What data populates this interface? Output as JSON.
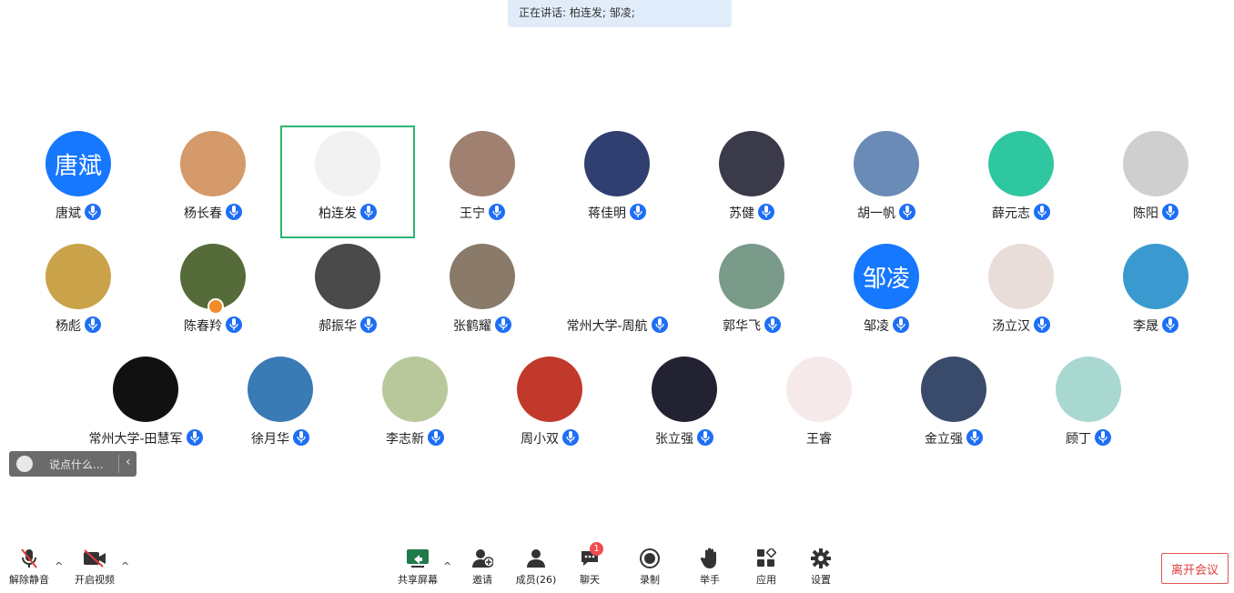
{
  "speaking_banner": "正在讲话: 柏连发; 邹凌;",
  "participants": [
    {
      "name": "唐斌",
      "avatar_text": "唐斌",
      "avatar_color": "#1677ff"
    },
    {
      "name": "杨长春",
      "avatar_color": "#d49a6a"
    },
    {
      "name": "柏连发",
      "avatar_color": "#f2f2f2"
    },
    {
      "name": "王宁",
      "avatar_color": "#a08070"
    },
    {
      "name": "蒋佳明",
      "avatar_color": "#2f3f6f"
    },
    {
      "name": "苏健",
      "avatar_color": "#3a3a4a"
    },
    {
      "name": "胡一帆",
      "avatar_color": "#6a8bb5"
    },
    {
      "name": "薛元志",
      "avatar_color": "#2fc7a0"
    },
    {
      "name": "陈阳",
      "avatar_color": "#cfcfcf"
    },
    {
      "name": "杨彪",
      "avatar_color": "#c9a24a"
    },
    {
      "name": "陈春羚",
      "avatar_color": "#556b3a"
    },
    {
      "name": "郝振华",
      "avatar_color": "#4a4a4a"
    },
    {
      "name": "张鹤耀",
      "avatar_color": "#8a7a6a"
    },
    {
      "name": "常州大学-周航",
      "avatar_color": "#ffffff"
    },
    {
      "name": "郭华飞",
      "avatar_color": "#7a9a8a"
    },
    {
      "name": "邹凌",
      "avatar_text": "邹凌",
      "avatar_color": "#1677ff"
    },
    {
      "name": "汤立汉",
      "avatar_color": "#e8ddd8"
    },
    {
      "name": "李晟",
      "avatar_color": "#3a9ad0"
    },
    {
      "name": "常州大学-田慧军",
      "avatar_color": "#111111"
    },
    {
      "name": "徐月华",
      "avatar_color": "#3a7ab5"
    },
    {
      "name": "李志新",
      "avatar_color": "#b8c89a"
    },
    {
      "name": "周小双",
      "avatar_color": "#c0392b"
    },
    {
      "name": "张立强",
      "avatar_color": "#222233"
    },
    {
      "name": "王睿",
      "avatar_color": "#f6e9ea"
    },
    {
      "name": "金立强",
      "avatar_color": "#3a4a6a"
    },
    {
      "name": "顾丁",
      "avatar_color": "#a8d8d0"
    }
  ],
  "chat_placeholder": "说点什么...",
  "toolbar": {
    "unmute": "解除静音",
    "start_video": "开启视频",
    "share_screen": "共享屏幕",
    "invite": "邀请",
    "members": "成员(26)",
    "chat": "聊天",
    "chat_badge": "1",
    "record": "录制",
    "raise_hand": "举手",
    "apps": "应用",
    "settings": "设置",
    "leave": "离开会议"
  }
}
